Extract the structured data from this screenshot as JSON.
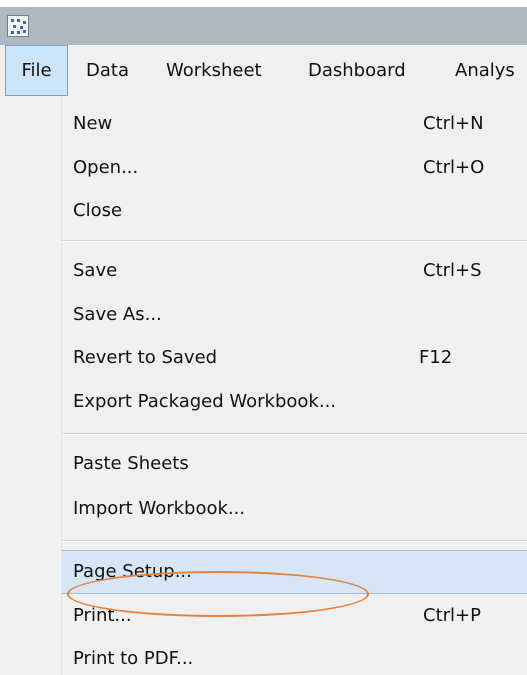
{
  "window": {
    "app_icon": "tableau-app-icon"
  },
  "menubar": {
    "items": [
      {
        "label": "File",
        "active": true
      },
      {
        "label": "Data"
      },
      {
        "label": "Worksheet"
      },
      {
        "label": "Dashboard"
      },
      {
        "label": "Analys"
      }
    ]
  },
  "file_menu": {
    "items": [
      {
        "label": "New",
        "shortcut": "Ctrl+N"
      },
      {
        "label": "Open...",
        "shortcut": "Ctrl+O"
      },
      {
        "label": "Close",
        "shortcut": ""
      },
      {
        "label": "Save",
        "shortcut": "Ctrl+S"
      },
      {
        "label": "Save As...",
        "shortcut": ""
      },
      {
        "label": "Revert to Saved",
        "shortcut": "F12"
      },
      {
        "label": "Export Packaged Workbook...",
        "shortcut": ""
      },
      {
        "label": "Paste Sheets",
        "shortcut": ""
      },
      {
        "label": "Import Workbook...",
        "shortcut": ""
      },
      {
        "label": "Page Setup...",
        "shortcut": "",
        "highlighted": true
      },
      {
        "label": "Print...",
        "shortcut": "Ctrl+P"
      },
      {
        "label": "Print to PDF...",
        "shortcut": ""
      }
    ]
  },
  "annotation": {
    "shape": "ellipse",
    "color": "#e8803a",
    "target": "Page Setup..."
  },
  "colors": {
    "titlebar": "#aeb8bf",
    "menu_background": "#f0f0f0",
    "active_menu": "#cce4f7",
    "highlight": "#d6e6f6"
  }
}
